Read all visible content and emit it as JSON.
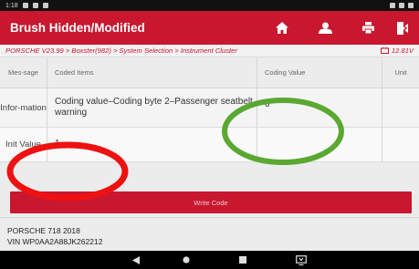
{
  "status_bar": {
    "time": "1:18"
  },
  "header": {
    "title": "Brush Hidden/Modified",
    "icons": [
      "home-icon",
      "user-icon",
      "print-icon",
      "exit-icon"
    ]
  },
  "breadcrumb": {
    "path": "PORSCHE V23.99 > Boxster(982) > System Selection > Instrument Cluster",
    "voltage": "12.81V"
  },
  "table": {
    "headers": {
      "message": "Mes-sage",
      "coded_items": "Coded Items",
      "coding_value": "Coding Value",
      "unit": "Unit"
    },
    "rows": [
      {
        "message": "Infor-mation",
        "item": "Coding value–Coding byte 2–Passenger seatbelt warning",
        "value": "0",
        "unit": ""
      },
      {
        "message": "Init Value",
        "item": "1",
        "value": "",
        "unit": ""
      }
    ]
  },
  "write_button": {
    "label": "Write Code"
  },
  "vehicle": {
    "model": "PORSCHE 718 2018",
    "vin": "VIN WP0AA2A88JK262212"
  },
  "colors": {
    "accent": "#c8172f",
    "annotation_red": "#ee1111",
    "annotation_green": "#5aa832"
  }
}
